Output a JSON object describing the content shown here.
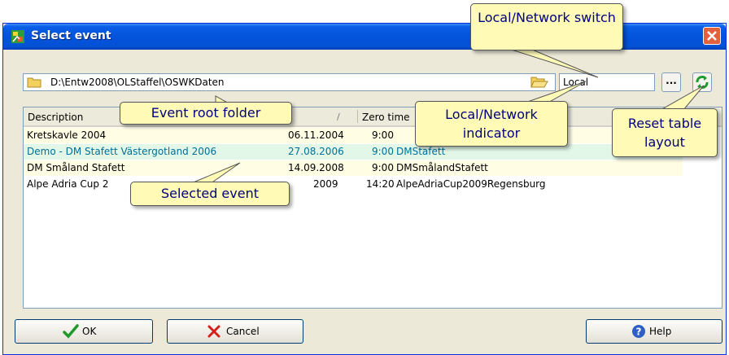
{
  "dialog": {
    "title": "Select event",
    "close_label": "X"
  },
  "path": {
    "value": "D:\\Entw2008\\OLStaffel\\OSWKDaten",
    "mode": "Local",
    "dots_label": "..."
  },
  "table": {
    "columns": [
      "Description",
      "/",
      "Zero time"
    ],
    "rows": [
      {
        "description": "Kretskavle 2004",
        "date": "06.11.2004",
        "time": "9:00",
        "folder": ""
      },
      {
        "description": "Demo - DM Stafett Västergotland 2006",
        "date": "27.08.2006",
        "time": "9:00",
        "folder": "DMStafett"
      },
      {
        "description": "DM Småland Stafett",
        "date": "14.09.2008",
        "time": "9:00",
        "folder": "DMSmålandStafett"
      },
      {
        "description": "Alpe Adria Cup 2",
        "date": "2009",
        "time": "14:20",
        "folder": "AlpeAdriaCup2009Regensburg"
      }
    ]
  },
  "buttons": {
    "ok": "OK",
    "cancel": "Cancel",
    "help": "Help"
  },
  "callouts": {
    "switch": "Local/Network switch",
    "root": "Event root folder",
    "indicator": "Local/Network indicator",
    "reset": "Reset table layout",
    "selected": "Selected event"
  },
  "colors": {
    "title_bar": "#0453dc",
    "row_odd": "#fffde3",
    "row_selected": "#e2f7e7",
    "selected_text": "#007099",
    "callout_bg": "#fffbb7",
    "callout_text": "#000080"
  }
}
